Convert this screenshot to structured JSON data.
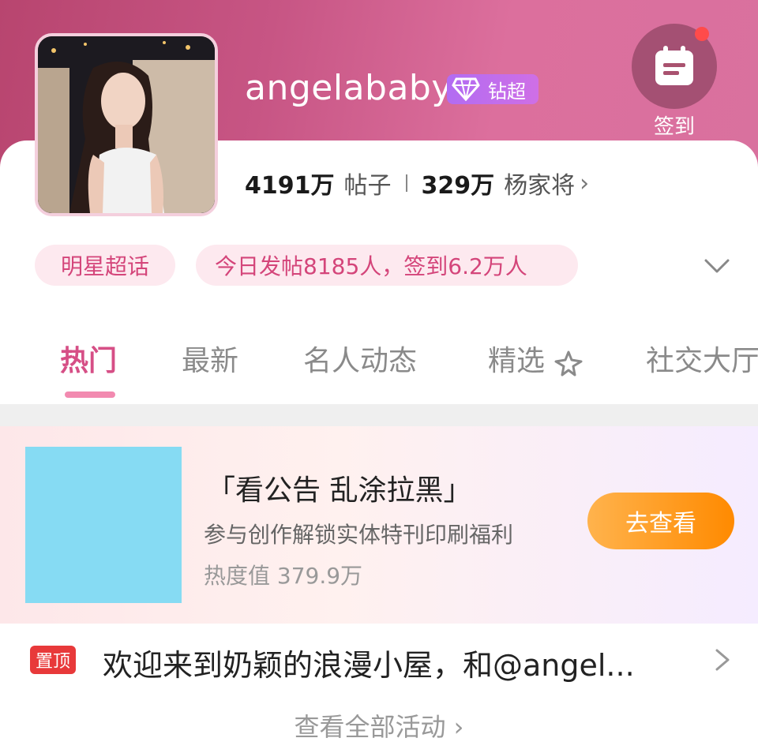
{
  "header": {
    "name": "angelababy",
    "badge_label": "钻超",
    "checkin_label": "签到"
  },
  "stats": {
    "posts_count": "4191万",
    "posts_label": "帖子",
    "fans_count": "329万",
    "fans_label": "杨家将",
    "chevron": "›"
  },
  "tags": {
    "category": "明星超话",
    "daily": "今日发帖8185人，签到6.2万人"
  },
  "tabs": [
    {
      "label": "热门"
    },
    {
      "label": "最新"
    },
    {
      "label": "名人动态"
    },
    {
      "label": "精选"
    },
    {
      "label": "社交大厅"
    }
  ],
  "promo": {
    "title": "「看公告 乱涂拉黑」",
    "subtitle": "参与创作解锁实体特刊印刷福利",
    "heat": "热度值 379.9万",
    "button": "去查看"
  },
  "pinned": {
    "badge": "置顶",
    "text": "欢迎来到奶颖的浪漫小屋，和@angel..."
  },
  "footer": {
    "view_all": "查看全部活动 ›"
  },
  "colors": {
    "accent_pink": "#d64f86",
    "banner_start": "#b8456f",
    "banner_end": "#d9719e",
    "badge_purple": "#b26cf2",
    "button_orange": "#ff8a00",
    "pin_red": "#e8393a",
    "promo_image": "#86dbf3"
  },
  "icons": [
    "calendar-icon",
    "notification-dot",
    "diamond-icon",
    "chevron-down-icon",
    "sparkle-icon",
    "chevron-right-icon"
  ]
}
